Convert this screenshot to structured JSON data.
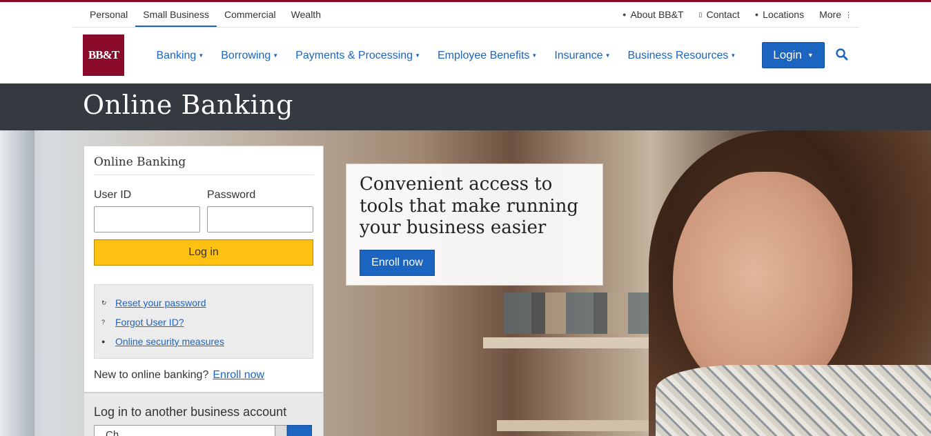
{
  "segments": [
    {
      "label": "Personal"
    },
    {
      "label": "Small Business"
    },
    {
      "label": "Commercial"
    },
    {
      "label": "Wealth"
    }
  ],
  "utility": {
    "about": "About BB&T",
    "contact": "Contact",
    "locations": "Locations",
    "more": "More"
  },
  "brand": {
    "logo_text": "BB&T",
    "color": "#8a0a2a"
  },
  "nav": {
    "items": [
      {
        "label": "Banking"
      },
      {
        "label": "Borrowing"
      },
      {
        "label": "Payments & Processing"
      },
      {
        "label": "Employee Benefits"
      },
      {
        "label": "Insurance"
      },
      {
        "label": "Business Resources"
      }
    ],
    "login_label": "Login"
  },
  "banner": {
    "title": "Online Banking"
  },
  "login_panel": {
    "title": "Online Banking",
    "user_id_label": "User ID",
    "password_label": "Password",
    "submit_label": "Log in",
    "help_links": [
      {
        "label": "Reset your password"
      },
      {
        "label": "Forgot User ID?"
      },
      {
        "label": "Online security measures"
      }
    ],
    "new_prompt": "New to online banking?",
    "enroll_link": "Enroll now"
  },
  "other_account": {
    "title": "Log in to another business account",
    "selected": "Ch"
  },
  "promo": {
    "headline": "Convenient access to tools that make running your business easier",
    "button": "Enroll now"
  },
  "colors": {
    "accent_blue": "#1b64c0",
    "login_yellow": "#fdc211",
    "banner_dark": "#343a40"
  }
}
